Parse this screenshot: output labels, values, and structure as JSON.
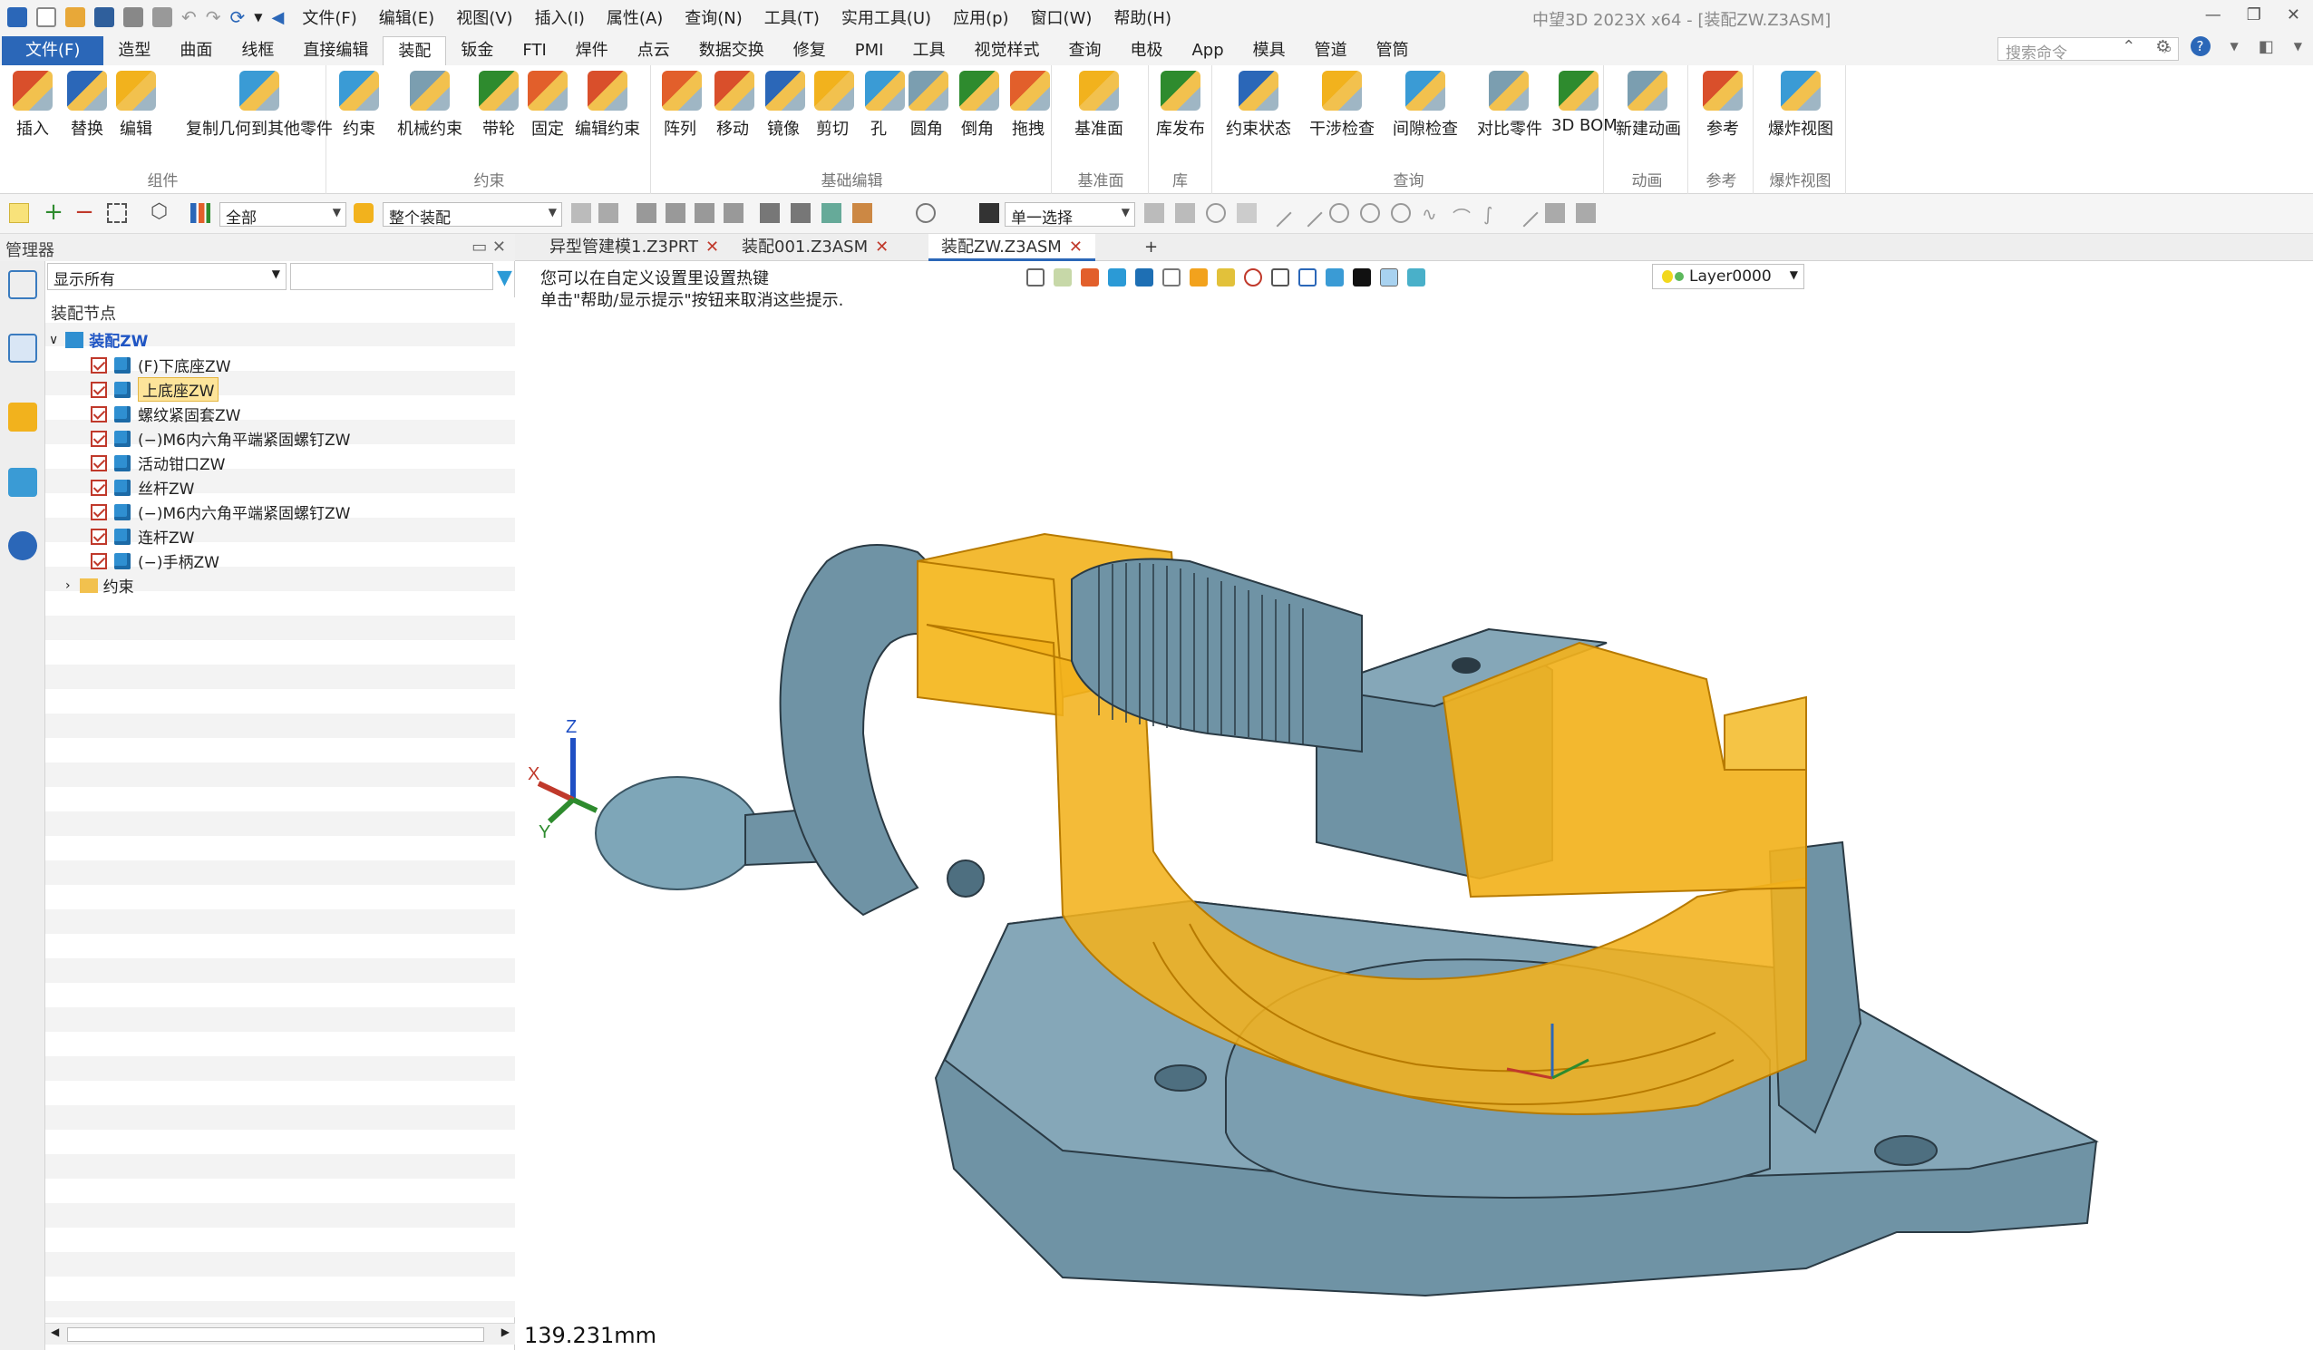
{
  "titlebar": {
    "menus": [
      "文件(F)",
      "编辑(E)",
      "视图(V)",
      "插入(I)",
      "属性(A)",
      "查询(N)",
      "工具(T)",
      "实用工具(U)",
      "应用(p)",
      "窗口(W)",
      "帮助(H)"
    ],
    "window_title": "中望3D 2023X x64 - [装配ZW.Z3ASM]"
  },
  "ribbon_tabs": [
    "文件(F)",
    "造型",
    "曲面",
    "线框",
    "直接编辑",
    "装配",
    "钣金",
    "FTI",
    "焊件",
    "点云",
    "数据交换",
    "修复",
    "PMI",
    "工具",
    "视觉样式",
    "查询",
    "电极",
    "App",
    "模具",
    "管道",
    "管筒"
  ],
  "active_tab": "装配",
  "command_search_placeholder": "搜索命令",
  "ribbon": {
    "groups": [
      {
        "label": "组件",
        "buttons": [
          "插入",
          "替换",
          "编辑",
          "复制几何到其他零件"
        ]
      },
      {
        "label": "约束",
        "buttons": [
          "约束",
          "机械约束",
          "带轮",
          "固定",
          "编辑约束"
        ]
      },
      {
        "label": "基础编辑",
        "buttons": [
          "阵列",
          "移动",
          "镜像",
          "剪切",
          "孔",
          "圆角",
          "倒角",
          "拖拽"
        ]
      },
      {
        "label": "基准面",
        "buttons": [
          "基准面"
        ]
      },
      {
        "label": "库",
        "buttons": [
          "库发布"
        ]
      },
      {
        "label": "查询",
        "buttons": [
          "约束状态",
          "干涉检查",
          "间隙检查",
          "对比零件",
          "3D BOM"
        ]
      },
      {
        "label": "动画",
        "buttons": [
          "新建动画"
        ]
      },
      {
        "label": "参考",
        "buttons": [
          "参考"
        ]
      },
      {
        "label": "爆炸视图",
        "buttons": [
          "爆炸视图"
        ]
      }
    ]
  },
  "toolbar": {
    "filter_value": "全部",
    "scope_value": "整个装配",
    "select_mode_value": "单一选择"
  },
  "manager": {
    "title": "管理器",
    "filter_value": "显示所有",
    "tree_header": "装配节点",
    "root": "装配ZW",
    "nodes": [
      "(F)下底座ZW",
      "上底座ZW",
      "螺纹紧固套ZW",
      "(−)M6内六角平端紧固螺钉ZW",
      "活动钳口ZW",
      "丝杆ZW",
      "(−)M6内六角平端紧固螺钉ZW",
      "连杆ZW",
      "(−)手柄ZW"
    ],
    "selected_node": "上底座ZW",
    "folder": "约束"
  },
  "doc_tabs": [
    {
      "label": "异型管建模1.Z3PRT",
      "active": false
    },
    {
      "label": "装配001.Z3ASM",
      "active": false
    },
    {
      "label": "装配ZW.Z3ASM",
      "active": true
    }
  ],
  "viewport": {
    "hint_line1": "您可以在自定义设置里设置热键",
    "hint_line2": "单击\"帮助/显示提示\"按钮来取消这些提示.",
    "layer": "Layer0000",
    "measure": "139.231mm",
    "axes": {
      "x": "X",
      "y": "Y",
      "z": "Z"
    }
  },
  "colors": {
    "accent": "#2b67b8",
    "highlight": "#f2b21d",
    "steel": "#6f93a5"
  }
}
